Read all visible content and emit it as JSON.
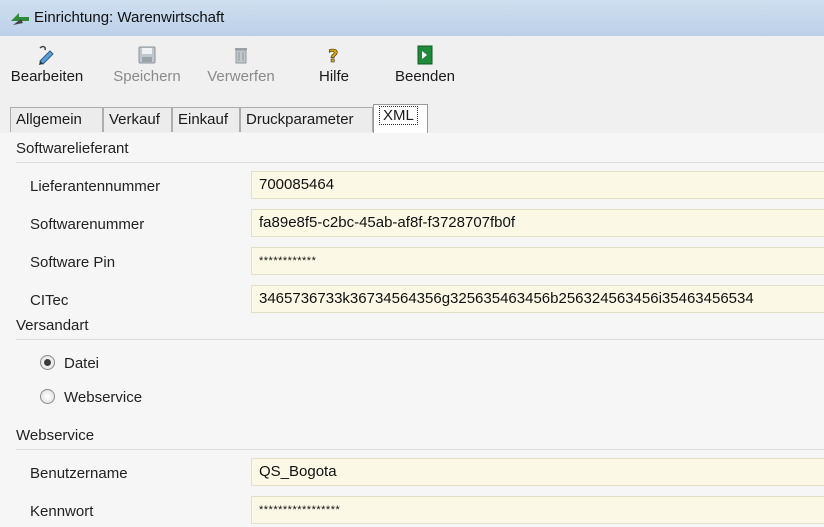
{
  "window": {
    "title": "Einrichtung: Warenwirtschaft"
  },
  "toolbar": {
    "edit_label": "Bearbeiten",
    "save_label": "Speichern",
    "discard_label": "Verwerfen",
    "help_label": "Hilfe",
    "exit_label": "Beenden"
  },
  "tabs": [
    {
      "label": "Allgemein"
    },
    {
      "label": "Verkauf"
    },
    {
      "label": "Einkauf"
    },
    {
      "label": "Druckparameter"
    },
    {
      "label": "XML",
      "active": true
    }
  ],
  "softwarelieferant": {
    "header": "Softwarelieferant",
    "supplier_number_label": "Lieferantennummer",
    "supplier_number_value": "700085464",
    "software_number_label": "Softwarenummer",
    "software_number_value": "fa89e8f5-c2bc-45ab-af8f-f3728707fb0f",
    "software_pin_label": "Software Pin",
    "software_pin_value": "************",
    "citec_label": "CITec",
    "citec_value": "3465736733k36734564356g325635463456b256324563456i35463456534"
  },
  "versandart": {
    "header": "Versandart",
    "option_file": "Datei",
    "option_webservice": "Webservice",
    "selected": "Datei"
  },
  "webservice": {
    "header": "Webservice",
    "username_label": "Benutzername",
    "username_value": "QS_Bogota",
    "password_label": "Kennwort",
    "password_value": "*****************"
  }
}
